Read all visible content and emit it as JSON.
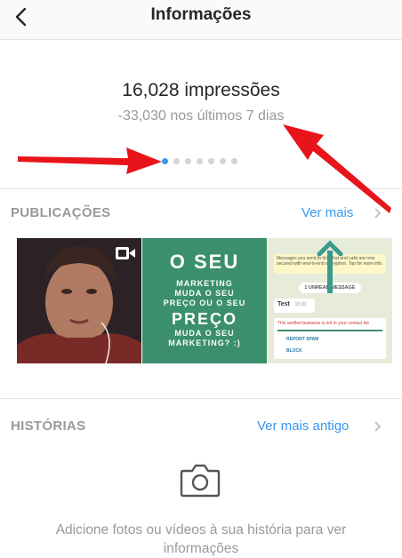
{
  "header": {
    "title": "Informações"
  },
  "stats": {
    "impressions": "16,028 impressões",
    "delta": "-33,030 nos últimos 7 dias",
    "pages": 7,
    "active_page": 1
  },
  "posts": {
    "label": "PUBLICAÇÕES",
    "link": "Ver mais",
    "thumbs": [
      {
        "type": "video"
      },
      {
        "line1": "O SEU",
        "line2": "MARKETING",
        "line3": "MUDA O SEU",
        "line4": "PREÇO OU O SEU",
        "line5": "PREÇO",
        "line6": "MUDA O SEU",
        "line7": "MARKETING? :)"
      },
      {
        "banner": "Messages you send to this chat and calls are now secured with end-to-end encryption. Tap for more info.",
        "unread": "1 UNREAD MESSAGE",
        "msg": "Test",
        "time": "23:30",
        "verified": "This verified business is not in your contact list",
        "report": "REPORT SPAM",
        "block": "BLOCK"
      }
    ]
  },
  "stories": {
    "label": "HISTÓRIAS",
    "link": "Ver mais antigo",
    "empty_line1": "Adicione fotos ou vídeos à sua história para ver",
    "empty_line2": "informações"
  },
  "colors": {
    "accent": "#3897f0",
    "annotation_arrow": "#e8141b",
    "green_post": "#3b8f6c"
  }
}
